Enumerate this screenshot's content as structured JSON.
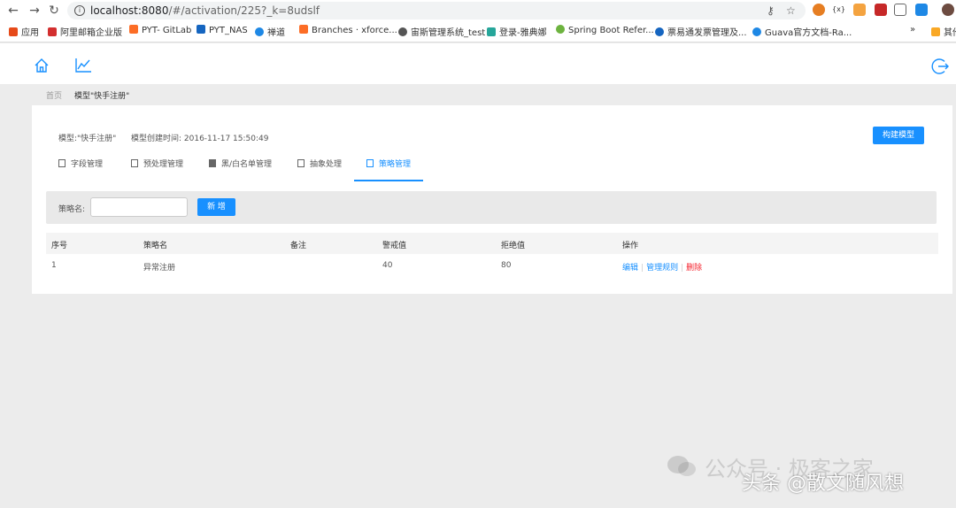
{
  "browser": {
    "url_host": "localhost:8080",
    "url_path": "/#/activation/225?_k=8udslf",
    "bookmarks": [
      {
        "label": "应用",
        "color": "#e64a19"
      },
      {
        "label": "阿里邮箱企业版",
        "color": "#d32f2f"
      },
      {
        "label": "PYT- GitLab",
        "color": "#fc6d26"
      },
      {
        "label": "PYT_NAS",
        "color": "#1565c0"
      },
      {
        "label": "禅道",
        "color": "#1e88e5"
      },
      {
        "label": "Branches · xforce...",
        "color": "#fc6d26"
      },
      {
        "label": "宙斯管理系统_test",
        "color": "#555555"
      },
      {
        "label": "登录-雅典娜",
        "color": "#26a69a"
      },
      {
        "label": "Spring Boot Refer...",
        "color": "#6db33f"
      },
      {
        "label": "票易通发票管理及...",
        "color": "#1565c0"
      },
      {
        "label": "Guava官方文档-Ra...",
        "color": "#1e88e5"
      },
      {
        "label": "»",
        "color": ""
      },
      {
        "label": "其他",
        "color": "#f9a825"
      }
    ]
  },
  "breadcrumb": {
    "home": "首页",
    "current": "模型\"快手注册\""
  },
  "model": {
    "name": "模型:\"快手注册\"",
    "created": "模型创建时间: 2016-11-17 15:50:49",
    "build_label": "构建模型"
  },
  "tabs": [
    {
      "label": "字段管理",
      "icon": "document-icon"
    },
    {
      "label": "预处理管理",
      "icon": "document-icon"
    },
    {
      "label": "黑/白名单管理",
      "icon": "grid-icon"
    },
    {
      "label": "抽象处理",
      "icon": "image-icon"
    },
    {
      "label": "策略管理",
      "icon": "edit-icon",
      "active": true
    }
  ],
  "search": {
    "label": "策略名:",
    "value": "",
    "add_label": "新 增"
  },
  "table": {
    "headers": [
      "序号",
      "策略名",
      "备注",
      "警戒值",
      "拒绝值",
      "操作"
    ],
    "rows": [
      {
        "index": "1",
        "name": "异常注册",
        "note": "",
        "warn": "40",
        "reject": "80"
      }
    ],
    "actions": {
      "edit": "编辑",
      "manage": "管理规则",
      "delete": "删除",
      "sep": "|"
    }
  },
  "watermark": {
    "main": "公众号 · 极客之家",
    "sub": "头条 @散文随风想"
  }
}
